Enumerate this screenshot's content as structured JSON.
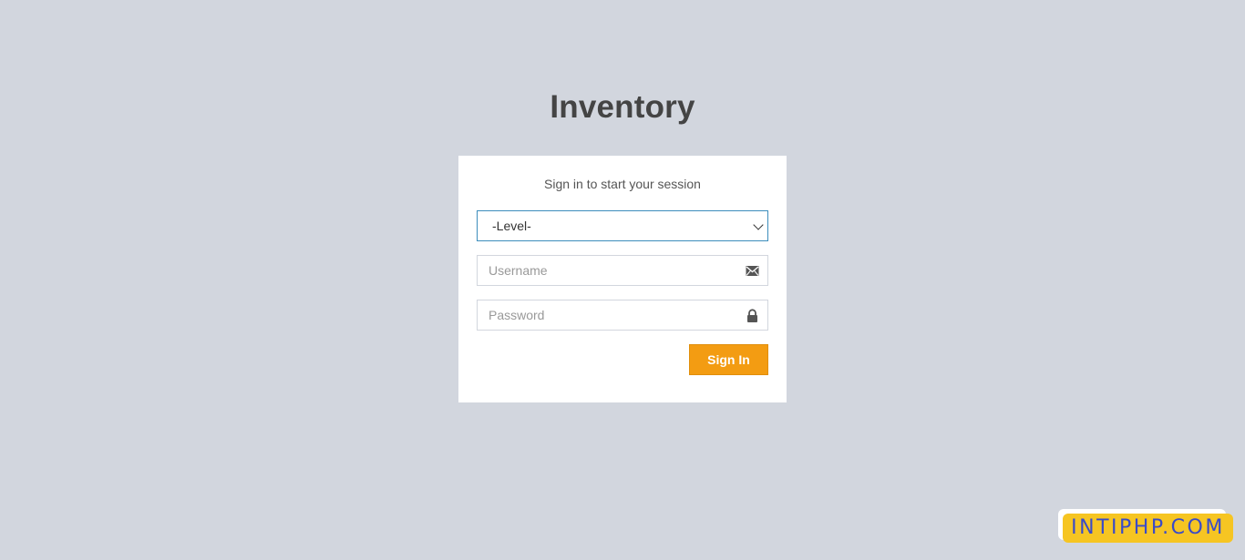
{
  "app": {
    "title": "Inventory"
  },
  "login": {
    "message": "Sign in to start your session",
    "level_select": {
      "selected": "-Level-"
    },
    "username": {
      "placeholder": "Username",
      "icon": "envelope-icon"
    },
    "password": {
      "placeholder": "Password",
      "icon": "lock-icon"
    },
    "submit_label": "Sign In"
  },
  "watermark": {
    "text": "INTIPHP.COM"
  },
  "colors": {
    "background": "#d2d6de",
    "accent": "#f39c12",
    "select_border": "#3c8dbc",
    "watermark_bg": "#f6c522",
    "watermark_text": "#3a4bc8"
  }
}
